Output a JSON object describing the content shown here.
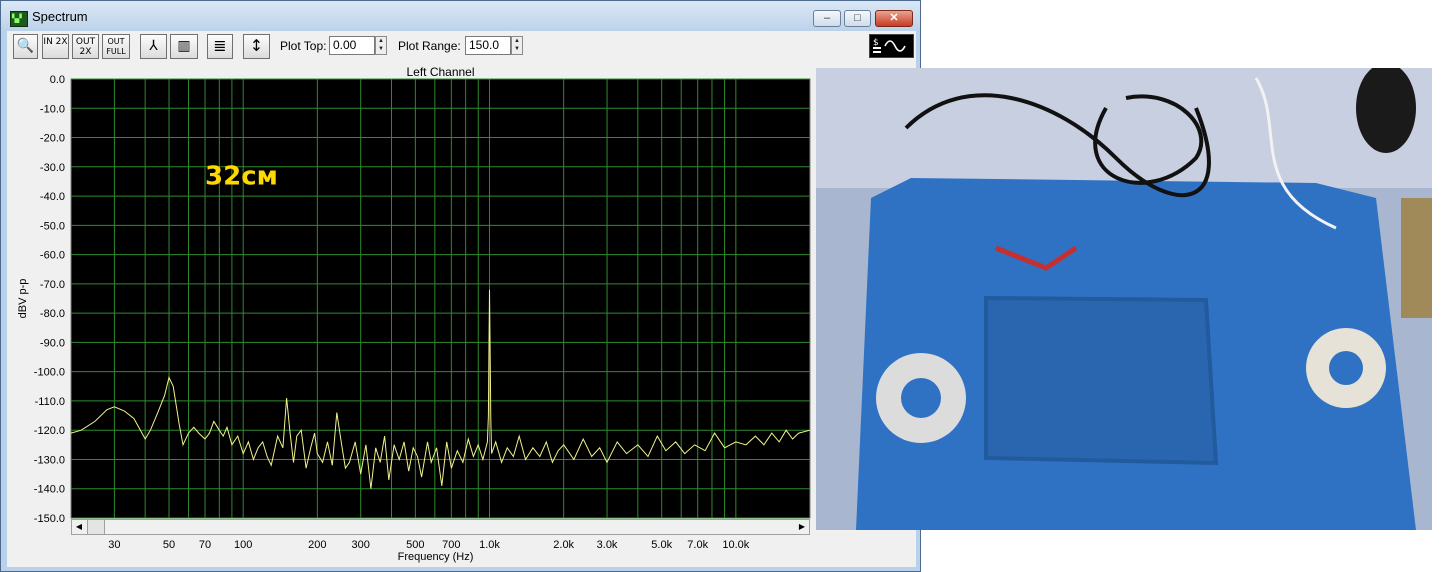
{
  "window": {
    "title": "Spectrum",
    "icon": "spectrum-app-icon",
    "controls": {
      "minimize": "–",
      "maximize": "□",
      "close": "✕"
    }
  },
  "toolbar": {
    "buttons": [
      {
        "name": "zoom-icon",
        "label": "🔍"
      },
      {
        "name": "zoom-in-2x-icon",
        "label": "IN 2X"
      },
      {
        "name": "zoom-out-2x-icon",
        "label": "OUT 2X"
      },
      {
        "name": "zoom-out-full-icon",
        "label": "OUT FULL"
      },
      {
        "name": "line-mode-icon",
        "label": "⅄"
      },
      {
        "name": "bar-mode-icon",
        "label": "▥"
      },
      {
        "name": "settings-icon",
        "label": "≣"
      },
      {
        "name": "autoscale-icon",
        "label": "↕"
      }
    ],
    "plot_top_label": "Plot Top:",
    "plot_top_value": "0.00",
    "plot_range_label": "Plot Range:",
    "plot_range_value": "150.0",
    "signal_icon": "signal-generator-icon"
  },
  "chart_data": {
    "type": "line",
    "title": "Left Channel",
    "xlabel": "Frequency (Hz)",
    "ylabel": "dBV p-p",
    "annotation": "32см",
    "x_scale": "log",
    "xlim": [
      20,
      20000
    ],
    "ylim": [
      -150,
      0
    ],
    "grid": true,
    "colors": {
      "background": "#000000",
      "grid": "#2e8b2e",
      "trace": "#f2f28a",
      "annotation": "#ffd800"
    },
    "y_ticks": [
      "0.0",
      "-10.0",
      "-20.0",
      "-30.0",
      "-40.0",
      "-50.0",
      "-60.0",
      "-70.0",
      "-80.0",
      "-90.0",
      "-100.0",
      "-110.0",
      "-120.0",
      "-130.0",
      "-140.0",
      "-150.0"
    ],
    "x_tick_labels": [
      {
        "value": 30,
        "label": "30"
      },
      {
        "value": 50,
        "label": "50"
      },
      {
        "value": 70,
        "label": "70"
      },
      {
        "value": 100,
        "label": "100"
      },
      {
        "value": 200,
        "label": "200"
      },
      {
        "value": 300,
        "label": "300"
      },
      {
        "value": 500,
        "label": "500"
      },
      {
        "value": 700,
        "label": "700"
      },
      {
        "value": 1000,
        "label": "1.0k"
      },
      {
        "value": 2000,
        "label": "2.0k"
      },
      {
        "value": 3000,
        "label": "3.0k"
      },
      {
        "value": 5000,
        "label": "5.0k"
      },
      {
        "value": 7000,
        "label": "7.0k"
      },
      {
        "value": 10000,
        "label": "10.0k"
      }
    ],
    "series": [
      {
        "points": [
          [
            20,
            -121
          ],
          [
            22,
            -120
          ],
          [
            25,
            -117
          ],
          [
            28,
            -113
          ],
          [
            30,
            -112
          ],
          [
            33,
            -113.5
          ],
          [
            36,
            -116
          ],
          [
            40,
            -123
          ],
          [
            42,
            -120
          ],
          [
            45,
            -114
          ],
          [
            48,
            -108
          ],
          [
            50,
            -102
          ],
          [
            52,
            -105
          ],
          [
            55,
            -118
          ],
          [
            57,
            -125
          ],
          [
            60,
            -121
          ],
          [
            63,
            -119
          ],
          [
            66,
            -121
          ],
          [
            70,
            -123
          ],
          [
            73,
            -121
          ],
          [
            76,
            -117
          ],
          [
            80,
            -120
          ],
          [
            83,
            -122
          ],
          [
            86,
            -119
          ],
          [
            90,
            -125
          ],
          [
            95,
            -122
          ],
          [
            100,
            -128
          ],
          [
            105,
            -124
          ],
          [
            110,
            -130
          ],
          [
            115,
            -126
          ],
          [
            120,
            -124
          ],
          [
            125,
            -129
          ],
          [
            130,
            -132
          ],
          [
            138,
            -122
          ],
          [
            145,
            -126
          ],
          [
            150,
            -109
          ],
          [
            155,
            -121
          ],
          [
            160,
            -131
          ],
          [
            165,
            -122
          ],
          [
            172,
            -120
          ],
          [
            180,
            -133
          ],
          [
            188,
            -126
          ],
          [
            195,
            -121
          ],
          [
            200,
            -128
          ],
          [
            210,
            -131
          ],
          [
            220,
            -124
          ],
          [
            230,
            -132
          ],
          [
            240,
            -114
          ],
          [
            250,
            -124
          ],
          [
            260,
            -133
          ],
          [
            270,
            -131
          ],
          [
            285,
            -124
          ],
          [
            300,
            -135
          ],
          [
            315,
            -125
          ],
          [
            330,
            -140
          ],
          [
            345,
            -126
          ],
          [
            360,
            -131
          ],
          [
            375,
            -122
          ],
          [
            390,
            -137
          ],
          [
            410,
            -125
          ],
          [
            430,
            -130
          ],
          [
            450,
            -124
          ],
          [
            470,
            -134
          ],
          [
            490,
            -126
          ],
          [
            510,
            -129
          ],
          [
            530,
            -136
          ],
          [
            560,
            -124
          ],
          [
            580,
            -131
          ],
          [
            610,
            -126
          ],
          [
            640,
            -139
          ],
          [
            670,
            -124
          ],
          [
            700,
            -133
          ],
          [
            740,
            -127
          ],
          [
            780,
            -131
          ],
          [
            820,
            -123
          ],
          [
            860,
            -129
          ],
          [
            900,
            -125
          ],
          [
            940,
            -130
          ],
          [
            980,
            -124
          ],
          [
            990,
            -115
          ],
          [
            995,
            -90
          ],
          [
            1000,
            -72
          ],
          [
            1005,
            -88
          ],
          [
            1012,
            -116
          ],
          [
            1020,
            -128
          ],
          [
            1060,
            -124
          ],
          [
            1120,
            -131
          ],
          [
            1180,
            -126
          ],
          [
            1250,
            -129
          ],
          [
            1320,
            -122
          ],
          [
            1400,
            -130
          ],
          [
            1500,
            -126
          ],
          [
            1600,
            -129
          ],
          [
            1700,
            -124
          ],
          [
            1800,
            -131
          ],
          [
            1900,
            -127
          ],
          [
            2000,
            -125
          ],
          [
            2200,
            -130
          ],
          [
            2400,
            -123
          ],
          [
            2600,
            -129
          ],
          [
            2800,
            -126
          ],
          [
            3000,
            -131
          ],
          [
            3300,
            -124
          ],
          [
            3600,
            -128
          ],
          [
            4000,
            -125
          ],
          [
            4400,
            -129
          ],
          [
            4800,
            -122
          ],
          [
            5200,
            -127
          ],
          [
            5700,
            -124
          ],
          [
            6200,
            -128
          ],
          [
            6800,
            -125
          ],
          [
            7500,
            -127
          ],
          [
            8200,
            -121
          ],
          [
            9000,
            -126
          ],
          [
            10000,
            -124
          ],
          [
            11000,
            -125
          ],
          [
            12000,
            -122
          ],
          [
            13000,
            -125
          ],
          [
            14000,
            -121
          ],
          [
            15000,
            -124
          ],
          [
            16000,
            -120
          ],
          [
            17000,
            -123
          ],
          [
            18000,
            -121
          ],
          [
            20000,
            -120
          ]
        ]
      }
    ]
  },
  "photo": {
    "description_icon": "photo-coils-on-blue-mat"
  }
}
